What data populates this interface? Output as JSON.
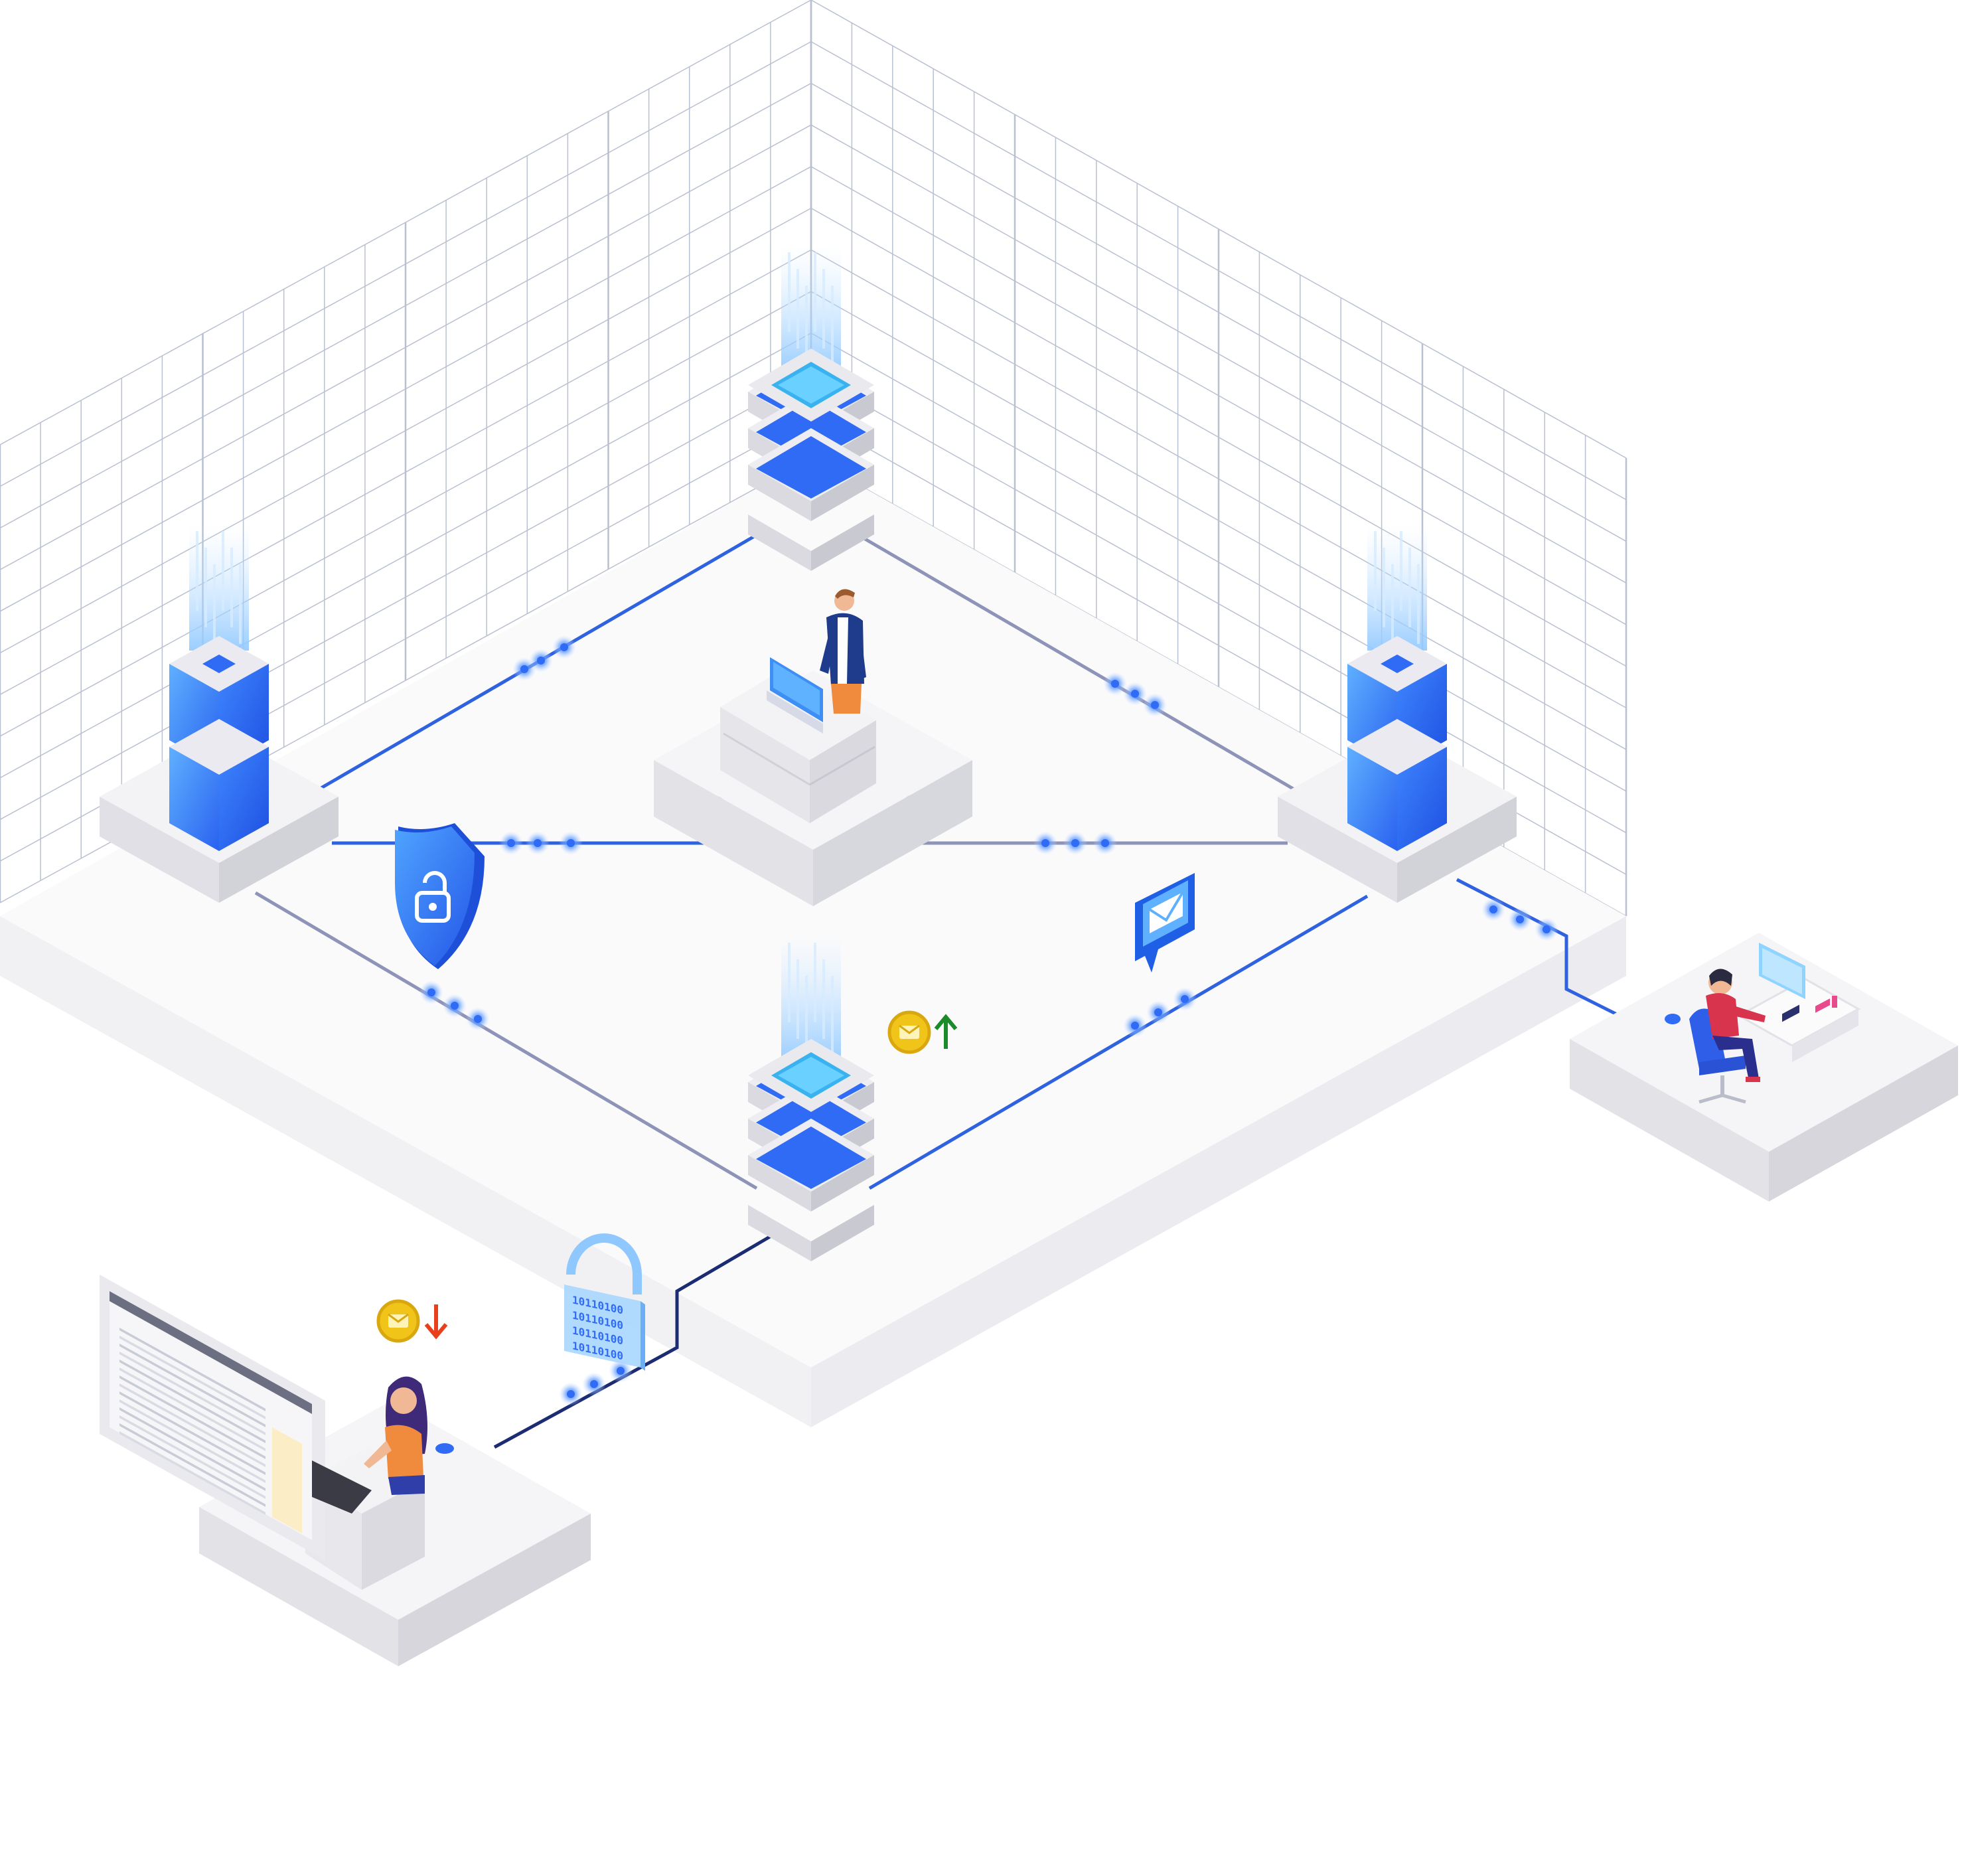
{
  "illustration": {
    "binary_tag": {
      "lines": [
        "10110100",
        "10110100",
        "10110100",
        "10110100"
      ]
    },
    "colors": {
      "primary_blue": "#2f6bf5",
      "light_blue": "#8fd3ff",
      "line_blue": "#2f62e0",
      "line_gray": "#8e94b8",
      "coin_gold": "#f0c419",
      "arrow_up": "#1a8a2a",
      "arrow_down": "#e8401c",
      "platform_top": "#f7f7f9",
      "platform_side": "#dcdce2",
      "grid_line": "#b9c0cf"
    },
    "icons": [
      "server-tower-icon",
      "shield-lock-icon",
      "mail-message-icon",
      "coin-icon",
      "arrow-up-icon",
      "arrow-down-icon",
      "padlock-binary-icon",
      "person-icon",
      "laptop-icon",
      "desk-icon",
      "chair-icon",
      "monitor-icon"
    ]
  }
}
